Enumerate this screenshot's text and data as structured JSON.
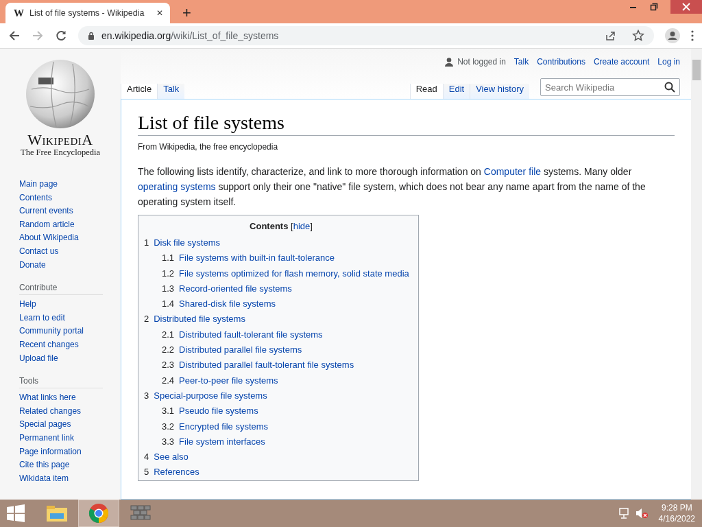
{
  "browser": {
    "tab": {
      "favicon": "W",
      "title": "List of file systems - Wikipedia",
      "close": "✕"
    },
    "new_tab": "+",
    "url": {
      "host": "en.wikipedia.org",
      "path": "/wiki/List_of_file_systems"
    }
  },
  "logo": {
    "wordmark": "WikipediA",
    "tagline": "The Free Encyclopedia"
  },
  "sidebar": {
    "sections": [
      {
        "items": [
          "Main page",
          "Contents",
          "Current events",
          "Random article",
          "About Wikipedia",
          "Contact us",
          "Donate"
        ]
      },
      {
        "heading": "Contribute",
        "items": [
          "Help",
          "Learn to edit",
          "Community portal",
          "Recent changes",
          "Upload file"
        ]
      },
      {
        "heading": "Tools",
        "items": [
          "What links here",
          "Related changes",
          "Special pages",
          "Permanent link",
          "Page information",
          "Cite this page",
          "Wikidata item"
        ]
      }
    ]
  },
  "personal_tools": {
    "status": "Not logged in",
    "links": [
      "Talk",
      "Contributions",
      "Create account",
      "Log in"
    ]
  },
  "namespace_tabs": [
    {
      "label": "Article",
      "selected": true
    },
    {
      "label": "Talk",
      "selected": false
    }
  ],
  "view_tabs": [
    {
      "label": "Read",
      "selected": true
    },
    {
      "label": "Edit",
      "selected": false
    },
    {
      "label": "View history",
      "selected": false
    }
  ],
  "search": {
    "placeholder": "Search Wikipedia"
  },
  "article": {
    "title": "List of file systems",
    "tagline": "From Wikipedia, the free encyclopedia",
    "intro": [
      {
        "text": "The following lists identify, characterize, and link to more thorough information on ",
        "link": false
      },
      {
        "text": "Computer file",
        "link": true
      },
      {
        "text": " systems. Many older ",
        "link": false
      },
      {
        "text": "operating systems",
        "link": true
      },
      {
        "text": " support only their one \"native\" file system, which does not bear any name apart from the name of the operating system itself.",
        "link": false
      }
    ]
  },
  "toc": {
    "title": "Contents",
    "toggle_open": "[",
    "toggle": "hide",
    "toggle_close": "]",
    "items": [
      {
        "number": "1",
        "label": "Disk file systems",
        "children": [
          {
            "number": "1.1",
            "label": "File systems with built-in fault-tolerance"
          },
          {
            "number": "1.2",
            "label": "File systems optimized for flash memory, solid state media"
          },
          {
            "number": "1.3",
            "label": "Record-oriented file systems"
          },
          {
            "number": "1.4",
            "label": "Shared-disk file systems"
          }
        ]
      },
      {
        "number": "2",
        "label": "Distributed file systems",
        "children": [
          {
            "number": "2.1",
            "label": "Distributed fault-tolerant file systems"
          },
          {
            "number": "2.2",
            "label": "Distributed parallel file systems"
          },
          {
            "number": "2.3",
            "label": "Distributed parallel fault-tolerant file systems"
          },
          {
            "number": "2.4",
            "label": "Peer-to-peer file systems"
          }
        ]
      },
      {
        "number": "3",
        "label": "Special-purpose file systems",
        "children": [
          {
            "number": "3.1",
            "label": "Pseudo file systems"
          },
          {
            "number": "3.2",
            "label": "Encrypted file systems"
          },
          {
            "number": "3.3",
            "label": "File system interfaces"
          }
        ]
      },
      {
        "number": "4",
        "label": "See also"
      },
      {
        "number": "5",
        "label": "References"
      }
    ]
  },
  "taskbar": {
    "apps": [
      {
        "kind": "explorer",
        "selected": false
      },
      {
        "kind": "chrome",
        "selected": true
      },
      {
        "kind": "wall",
        "selected": false
      }
    ],
    "time": "9:28 PM",
    "date": "4/16/2022"
  }
}
